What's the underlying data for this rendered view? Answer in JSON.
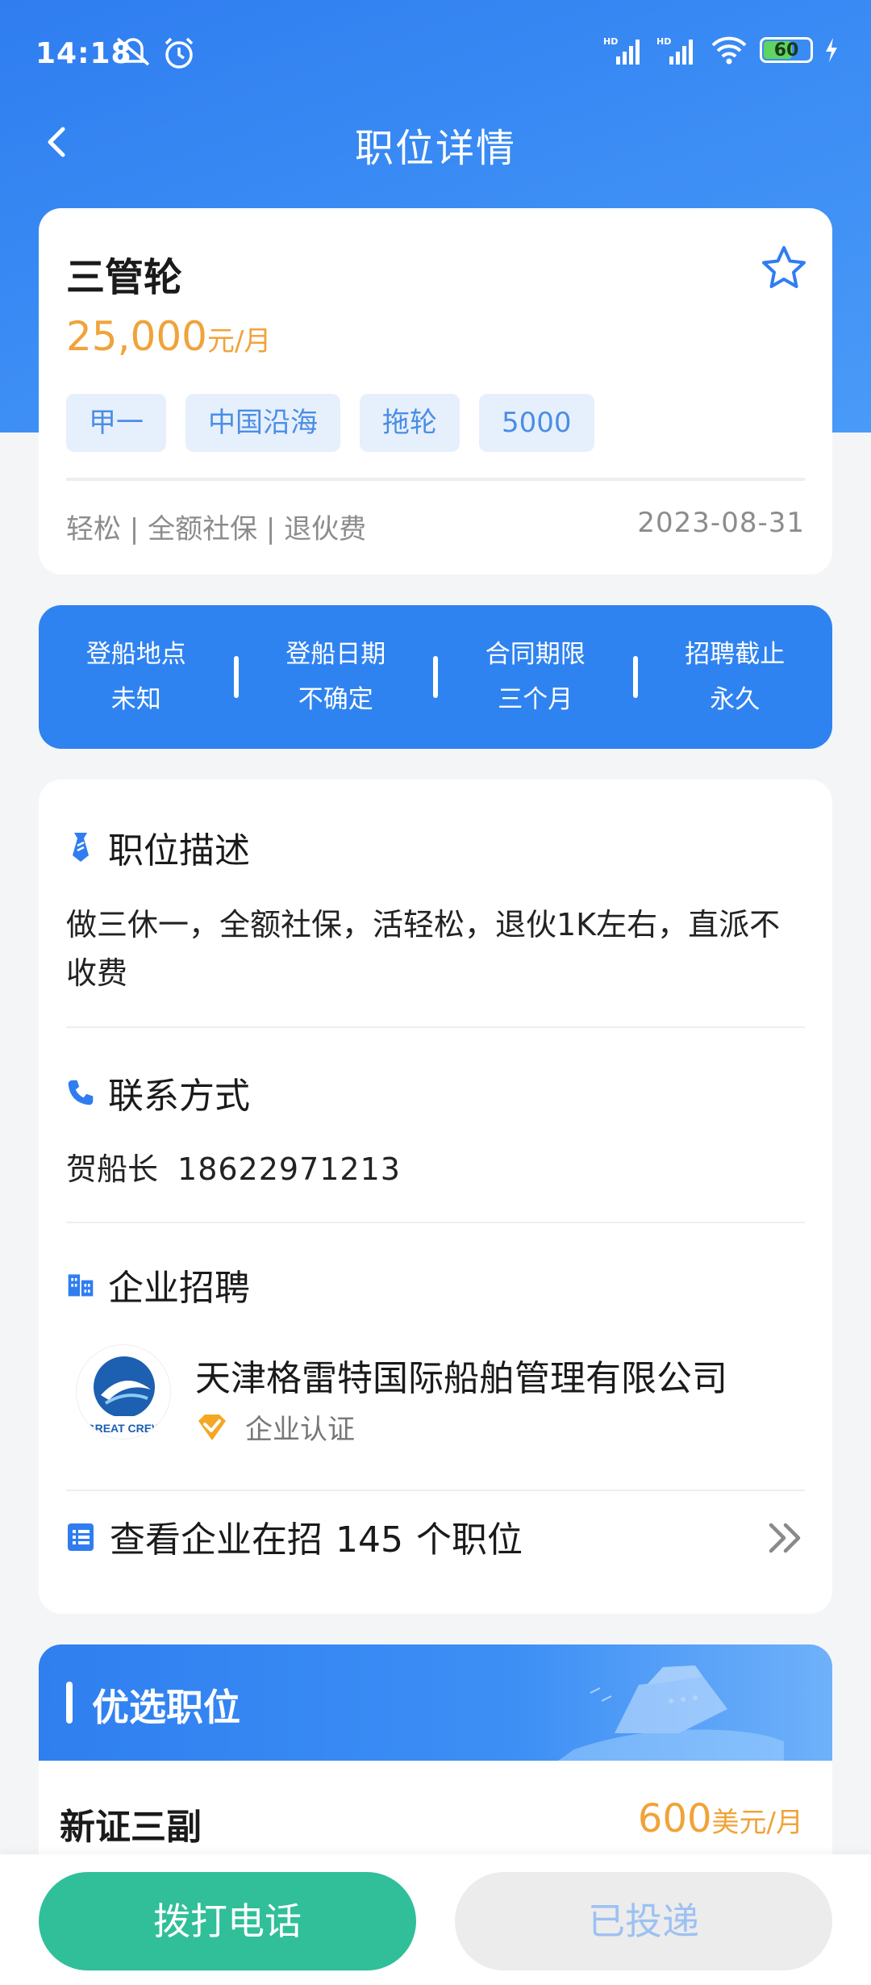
{
  "status_bar": {
    "time": "14:18",
    "battery": "60"
  },
  "nav": {
    "title": "职位详情"
  },
  "job": {
    "title": "三管轮",
    "salary_amount": "25,000",
    "salary_unit": "元/月",
    "tags": [
      "甲一",
      "中国沿海",
      "拖轮",
      "5000"
    ],
    "benefits": "轻松 | 全额社保 | 退伙费",
    "date": "2023-08-31"
  },
  "info": [
    {
      "label": "登船地点",
      "value": "未知"
    },
    {
      "label": "登船日期",
      "value": "不确定"
    },
    {
      "label": "合同期限",
      "value": "三个月"
    },
    {
      "label": "招聘截止",
      "value": "永久"
    }
  ],
  "description": {
    "heading": "职位描述",
    "text": "做三休一，全额社保，活轻松，退伙1K左右，直派不收费"
  },
  "contact": {
    "heading": "联系方式",
    "name": "贺船长",
    "phone": "18622971213"
  },
  "company": {
    "heading": "企业招聘",
    "name": "天津格雷特国际船舶管理有限公司",
    "verified_label": "企业认证",
    "logo_text": "GREAT CREW",
    "jobs_prefix": "查看企业在招",
    "jobs_count": "145",
    "jobs_suffix": "个职位"
  },
  "preferred": {
    "heading": "优选职位",
    "job_title": "新证三副",
    "salary_amount": "600",
    "salary_unit": "美元/月"
  },
  "actions": {
    "call": "拨打电话",
    "applied": "已投递"
  },
  "colors": {
    "primary": "#2f83f0",
    "salary": "#f0a33a",
    "call_button": "#30bf99",
    "tag_bg": "#e6f0fc"
  }
}
